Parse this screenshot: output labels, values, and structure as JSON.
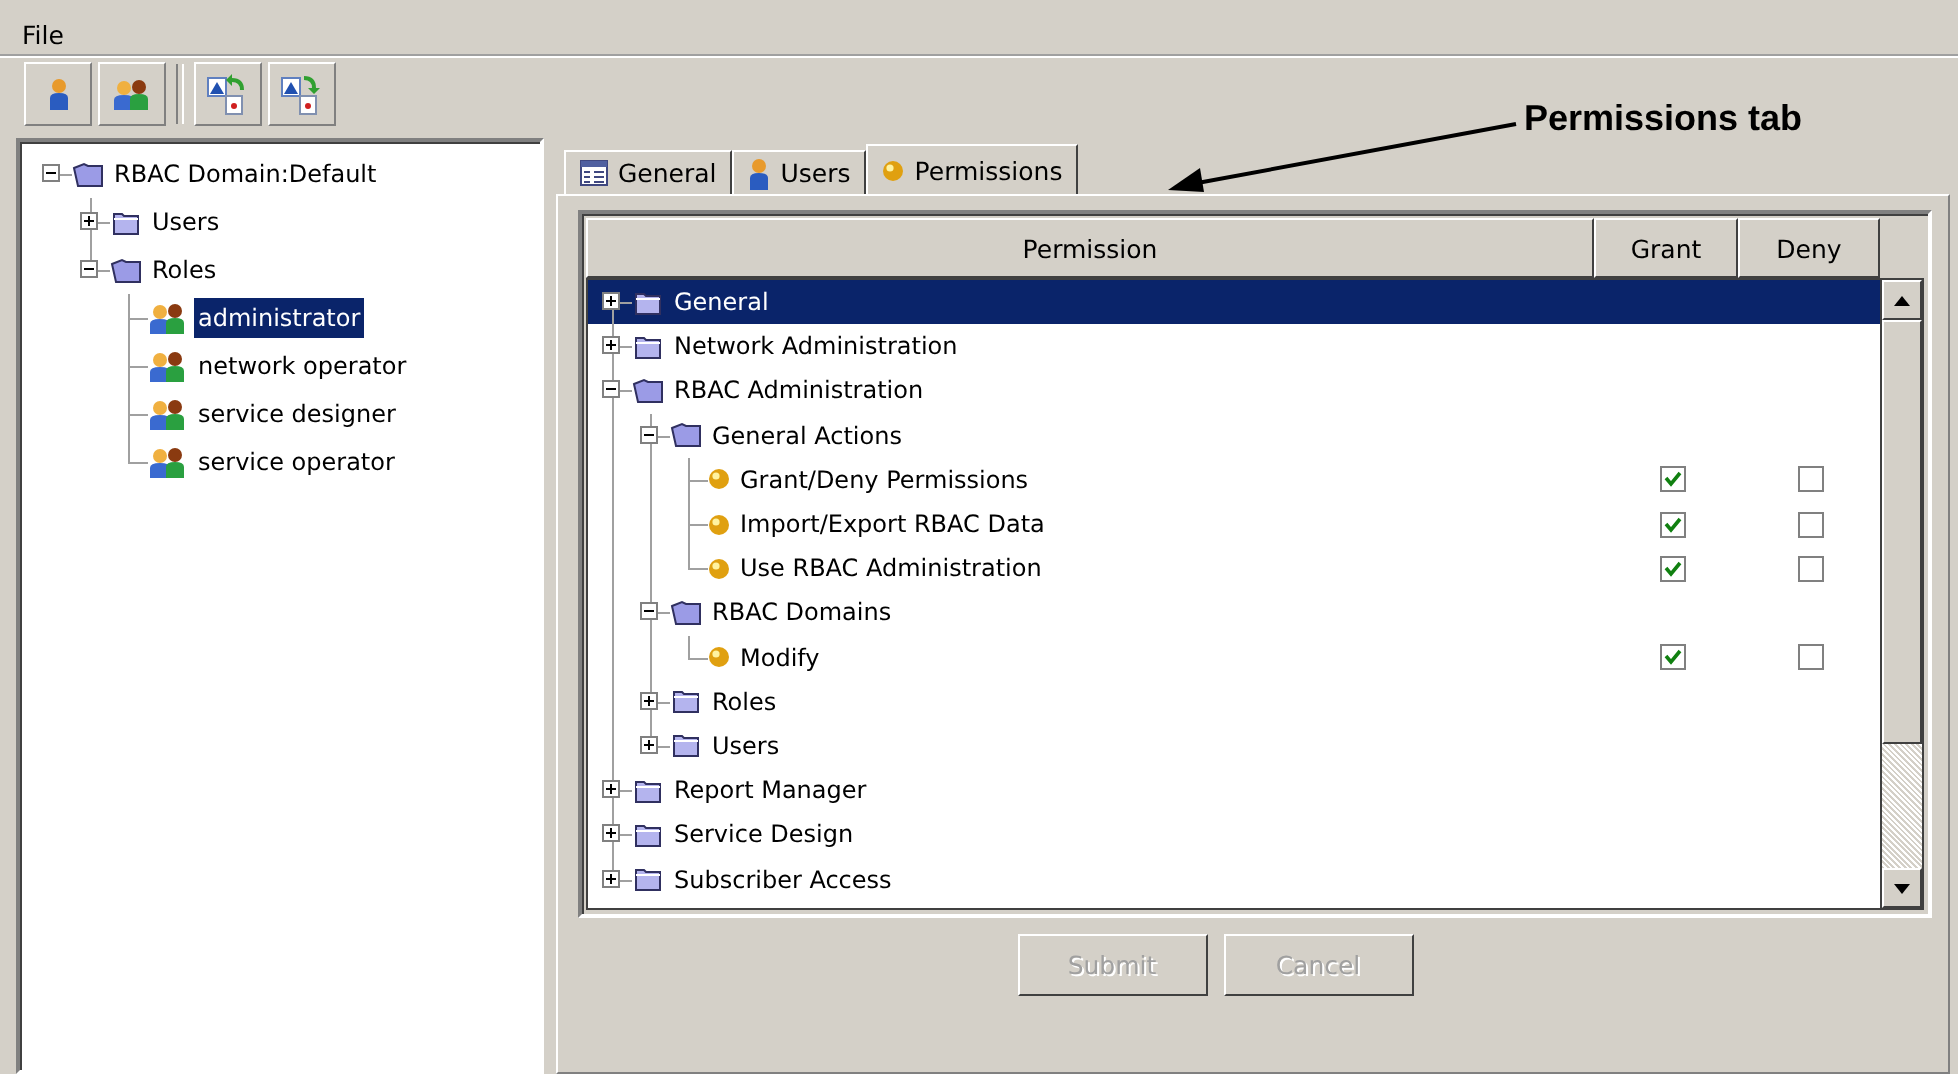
{
  "menu": [
    "File"
  ],
  "annotation": {
    "label": "Permissions tab"
  },
  "domain_tree": [
    {
      "label": "RBAC Domain:Default",
      "kind": "folder",
      "expanded": true,
      "selected": false,
      "children": [
        {
          "label": "Users",
          "kind": "folder",
          "expanded": false,
          "selected": false
        },
        {
          "label": "Roles",
          "kind": "folder",
          "expanded": true,
          "selected": false,
          "children": [
            {
              "label": "administrator",
              "kind": "role",
              "selected": true
            },
            {
              "label": "network operator",
              "kind": "role",
              "selected": false
            },
            {
              "label": "service designer",
              "kind": "role",
              "selected": false
            },
            {
              "label": "service operator",
              "kind": "role",
              "selected": false
            }
          ]
        }
      ]
    }
  ],
  "tabs": [
    {
      "label": "General",
      "kind": "table",
      "selected": false
    },
    {
      "label": "Users",
      "kind": "user",
      "selected": false
    },
    {
      "label": "Permissions",
      "kind": "ball",
      "selected": true
    }
  ],
  "permissions": {
    "columns": [
      "Permission",
      "Grant",
      "Deny"
    ],
    "tree": [
      {
        "label": "General",
        "kind": "folder",
        "expanded": false,
        "selected": true
      },
      {
        "label": "Network Administration",
        "kind": "folder",
        "expanded": false,
        "selected": false
      },
      {
        "label": "RBAC Administration",
        "kind": "folder",
        "expanded": true,
        "selected": false,
        "children": [
          {
            "label": "General Actions",
            "kind": "folder",
            "expanded": true,
            "selected": false,
            "children": [
              {
                "label": "Grant/Deny Permissions",
                "kind": "permission",
                "selected": false,
                "grant": true,
                "deny": false
              },
              {
                "label": "Import/Export RBAC Data",
                "kind": "permission",
                "selected": false,
                "grant": true,
                "deny": false
              },
              {
                "label": "Use RBAC Administration",
                "kind": "permission",
                "selected": false,
                "grant": true,
                "deny": false
              }
            ]
          },
          {
            "label": "RBAC Domains",
            "kind": "folder",
            "expanded": true,
            "selected": false,
            "children": [
              {
                "label": "Modify",
                "kind": "permission",
                "selected": false,
                "grant": true,
                "deny": false
              }
            ]
          },
          {
            "label": "Roles",
            "kind": "folder",
            "expanded": false,
            "selected": false
          },
          {
            "label": "Users",
            "kind": "folder",
            "expanded": false,
            "selected": false
          }
        ]
      },
      {
        "label": "Report Manager",
        "kind": "folder",
        "expanded": false,
        "selected": false
      },
      {
        "label": "Service Design",
        "kind": "folder",
        "expanded": false,
        "selected": false
      },
      {
        "label": "Subscriber Access",
        "kind": "folder",
        "expanded": false,
        "selected": false
      }
    ]
  },
  "buttons": [
    {
      "label": "Submit",
      "disabled": true
    },
    {
      "label": "Cancel",
      "disabled": true
    }
  ]
}
